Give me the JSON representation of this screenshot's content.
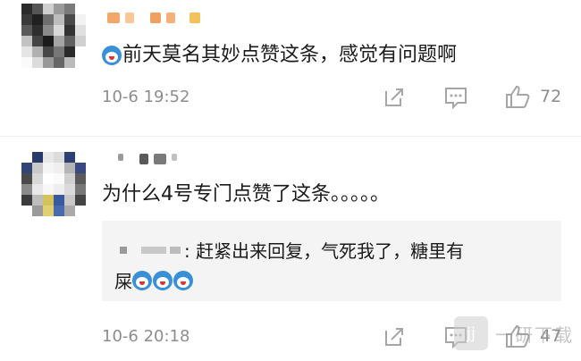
{
  "comments": [
    {
      "text": "前天莫名其妙点赞这条，感觉有问题啊",
      "time": "10-6 19:52",
      "likes": "72",
      "emoji_prefix": "doge-emoji"
    },
    {
      "text": "为什么4号专门点赞了这条。。。。。",
      "time": "10-6 20:18",
      "likes": "47",
      "reply": {
        "text_line1": ": 赶紧出来回复，气死我了，糖里有",
        "text_line2": "屎",
        "emoji_count": 3
      }
    }
  ],
  "watermark": {
    "logo": "jj",
    "text": "一研下载"
  },
  "icons": {
    "share": "share-icon",
    "comment": "comment-icon",
    "like": "thumbs-up-icon"
  }
}
